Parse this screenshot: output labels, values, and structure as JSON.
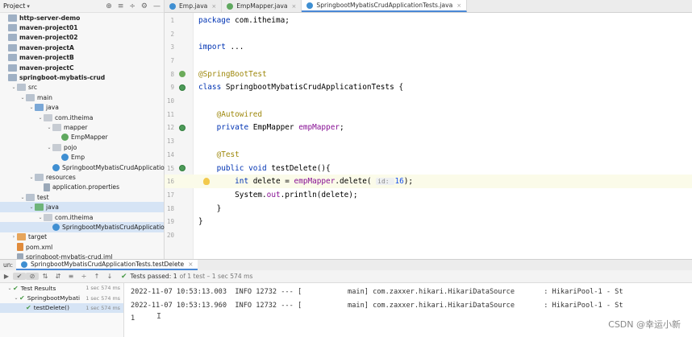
{
  "project": {
    "title": "Project",
    "caret": "▾",
    "toolbar": [
      "⊕",
      "≡",
      "÷",
      "⚙",
      "—"
    ],
    "tree": [
      {
        "label": "http-server-demo",
        "indent": 0,
        "arrow": "",
        "icon": "module",
        "bold": true
      },
      {
        "label": "maven-project01",
        "indent": 0,
        "arrow": "",
        "icon": "module",
        "bold": true
      },
      {
        "label": "maven-project02",
        "indent": 0,
        "arrow": "",
        "icon": "module",
        "bold": true
      },
      {
        "label": "maven-projectA",
        "indent": 0,
        "arrow": "",
        "icon": "module",
        "bold": true
      },
      {
        "label": "maven-projectB",
        "indent": 0,
        "arrow": "",
        "icon": "module",
        "bold": true
      },
      {
        "label": "maven-projectC",
        "indent": 0,
        "arrow": "",
        "icon": "module",
        "bold": true
      },
      {
        "label": "springboot-mybatis-crud",
        "indent": 0,
        "arrow": "",
        "icon": "module",
        "bold": true
      },
      {
        "label": "src",
        "indent": 1,
        "arrow": "⌄",
        "icon": "folder",
        "bold": false
      },
      {
        "label": "main",
        "indent": 2,
        "arrow": "⌄",
        "icon": "folder",
        "bold": false
      },
      {
        "label": "java",
        "indent": 3,
        "arrow": "⌄",
        "icon": "folder-blue",
        "bold": false
      },
      {
        "label": "com.itheima",
        "indent": 4,
        "arrow": "⌄",
        "icon": "pkg",
        "bold": false
      },
      {
        "label": "mapper",
        "indent": 5,
        "arrow": "⌄",
        "icon": "pkg",
        "bold": false
      },
      {
        "label": "EmpMapper",
        "indent": 6,
        "arrow": "",
        "icon": "iface",
        "bold": false
      },
      {
        "label": "pojo",
        "indent": 5,
        "arrow": "⌄",
        "icon": "pkg",
        "bold": false
      },
      {
        "label": "Emp",
        "indent": 6,
        "arrow": "",
        "icon": "cls",
        "bold": false
      },
      {
        "label": "SpringbootMybatisCrudApplication",
        "indent": 5,
        "arrow": "",
        "icon": "cls",
        "bold": false
      },
      {
        "label": "resources",
        "indent": 3,
        "arrow": "⌄",
        "icon": "folder",
        "bold": false
      },
      {
        "label": "application.properties",
        "indent": 4,
        "arrow": "",
        "icon": "file",
        "bold": false
      },
      {
        "label": "test",
        "indent": 2,
        "arrow": "⌄",
        "icon": "folder",
        "bold": false
      },
      {
        "label": "java",
        "indent": 3,
        "arrow": "⌄",
        "icon": "folder-green",
        "bold": false,
        "selected": true
      },
      {
        "label": "com.itheima",
        "indent": 4,
        "arrow": "⌄",
        "icon": "pkg",
        "bold": false
      },
      {
        "label": "SpringbootMybatisCrudApplicationT",
        "indent": 5,
        "arrow": "",
        "icon": "cls",
        "bold": false,
        "selected": true
      },
      {
        "label": "target",
        "indent": 1,
        "arrow": "›",
        "icon": "folder-orange",
        "bold": false
      },
      {
        "label": "pom.xml",
        "indent": 1,
        "arrow": "",
        "icon": "xml",
        "bold": false
      },
      {
        "label": "springboot-mybatis-crud.iml",
        "indent": 1,
        "arrow": "",
        "icon": "file",
        "bold": false
      }
    ]
  },
  "tabs": [
    {
      "label": "Emp.java",
      "icon": "cls",
      "active": false
    },
    {
      "label": "EmpMapper.java",
      "icon": "iface",
      "active": false
    },
    {
      "label": "SpringbootMybatisCrudApplicationTests.java",
      "icon": "cls",
      "active": true
    }
  ],
  "tab_close": "×",
  "editor": {
    "lines": [
      {
        "n": "1",
        "code": [
          [
            "kw",
            "package "
          ],
          [
            "",
            "com.itheima;"
          ]
        ]
      },
      {
        "n": "2",
        "code": []
      },
      {
        "n": "3",
        "code": [
          [
            "kw",
            "import "
          ],
          [
            "",
            "..."
          ]
        ]
      },
      {
        "n": "7",
        "code": []
      },
      {
        "n": "8",
        "code": [
          [
            "ann",
            "@SpringBootTest"
          ]
        ],
        "gicon": "green"
      },
      {
        "n": "9",
        "code": [
          [
            "kw",
            "class "
          ],
          [
            "",
            "SpringbootMybatisCrudApplicationTests {"
          ]
        ],
        "gicon": "green2"
      },
      {
        "n": "10",
        "code": []
      },
      {
        "n": "11",
        "code": [
          [
            "",
            "    "
          ],
          [
            "ann",
            "@Autowired"
          ]
        ]
      },
      {
        "n": "12",
        "code": [
          [
            "",
            "    "
          ],
          [
            "kw",
            "private "
          ],
          [
            "",
            "EmpMapper "
          ],
          [
            "fld",
            "empMapper"
          ],
          [
            "",
            ";"
          ]
        ],
        "gicon": "green2"
      },
      {
        "n": "13",
        "code": []
      },
      {
        "n": "14",
        "code": [
          [
            "",
            "    "
          ],
          [
            "ann",
            "@Test"
          ]
        ]
      },
      {
        "n": "15",
        "code": [
          [
            "",
            "    "
          ],
          [
            "kw",
            "public void "
          ],
          [
            "",
            "testDelete(){"
          ]
        ],
        "gicon": "green2"
      },
      {
        "n": "16",
        "code": [
          [
            "",
            "        "
          ],
          [
            "kw",
            "int "
          ],
          [
            "",
            "delete = "
          ],
          [
            "fld",
            "empMapper"
          ],
          [
            "",
            ".delete( "
          ],
          [
            "hint",
            "id: "
          ],
          [
            "num",
            "16"
          ],
          [
            "",
            ");"
          ]
        ],
        "current": true,
        "bulb": true
      },
      {
        "n": "17",
        "code": [
          [
            "",
            "        System."
          ],
          [
            "fld",
            "out"
          ],
          [
            "",
            ".println(delete);"
          ]
        ]
      },
      {
        "n": "18",
        "code": [
          [
            "",
            "    }"
          ]
        ]
      },
      {
        "n": "19",
        "code": [
          [
            "",
            "}"
          ]
        ]
      },
      {
        "n": "20",
        "code": []
      }
    ]
  },
  "run": {
    "label": "un:",
    "tab_label": "SpringbootMybatisCrudApplicationTests.testDelete",
    "close": "×",
    "tools": [
      "▶",
      "✔",
      "⊘",
      "⇅",
      "⇵",
      "≡",
      "÷",
      "↑",
      "↓"
    ],
    "status_text": "Tests passed: 1",
    "status_dim": "of 1 test – 1 sec 574 ms",
    "results": [
      {
        "label": "Test Results",
        "duration": "1 sec 574 ms",
        "indent": 1,
        "arrow": "⌄"
      },
      {
        "label": "SpringbootMybati",
        "duration": "1 sec 574 ms",
        "indent": 2,
        "arrow": "⌄"
      },
      {
        "label": "testDelete()",
        "duration": "1 sec 574 ms",
        "indent": 3,
        "arrow": "",
        "selected": true
      }
    ],
    "console": [
      "2022-11-07 10:53:13.003  INFO 12732 --- [           main] com.zaxxer.hikari.HikariDataSource       : HikariPool-1 - St",
      "2022-11-07 10:53:13.960  INFO 12732 --- [           main] com.zaxxer.hikari.HikariDataSource       : HikariPool-1 - St",
      "1"
    ]
  },
  "watermark": "CSDN @幸运小新"
}
